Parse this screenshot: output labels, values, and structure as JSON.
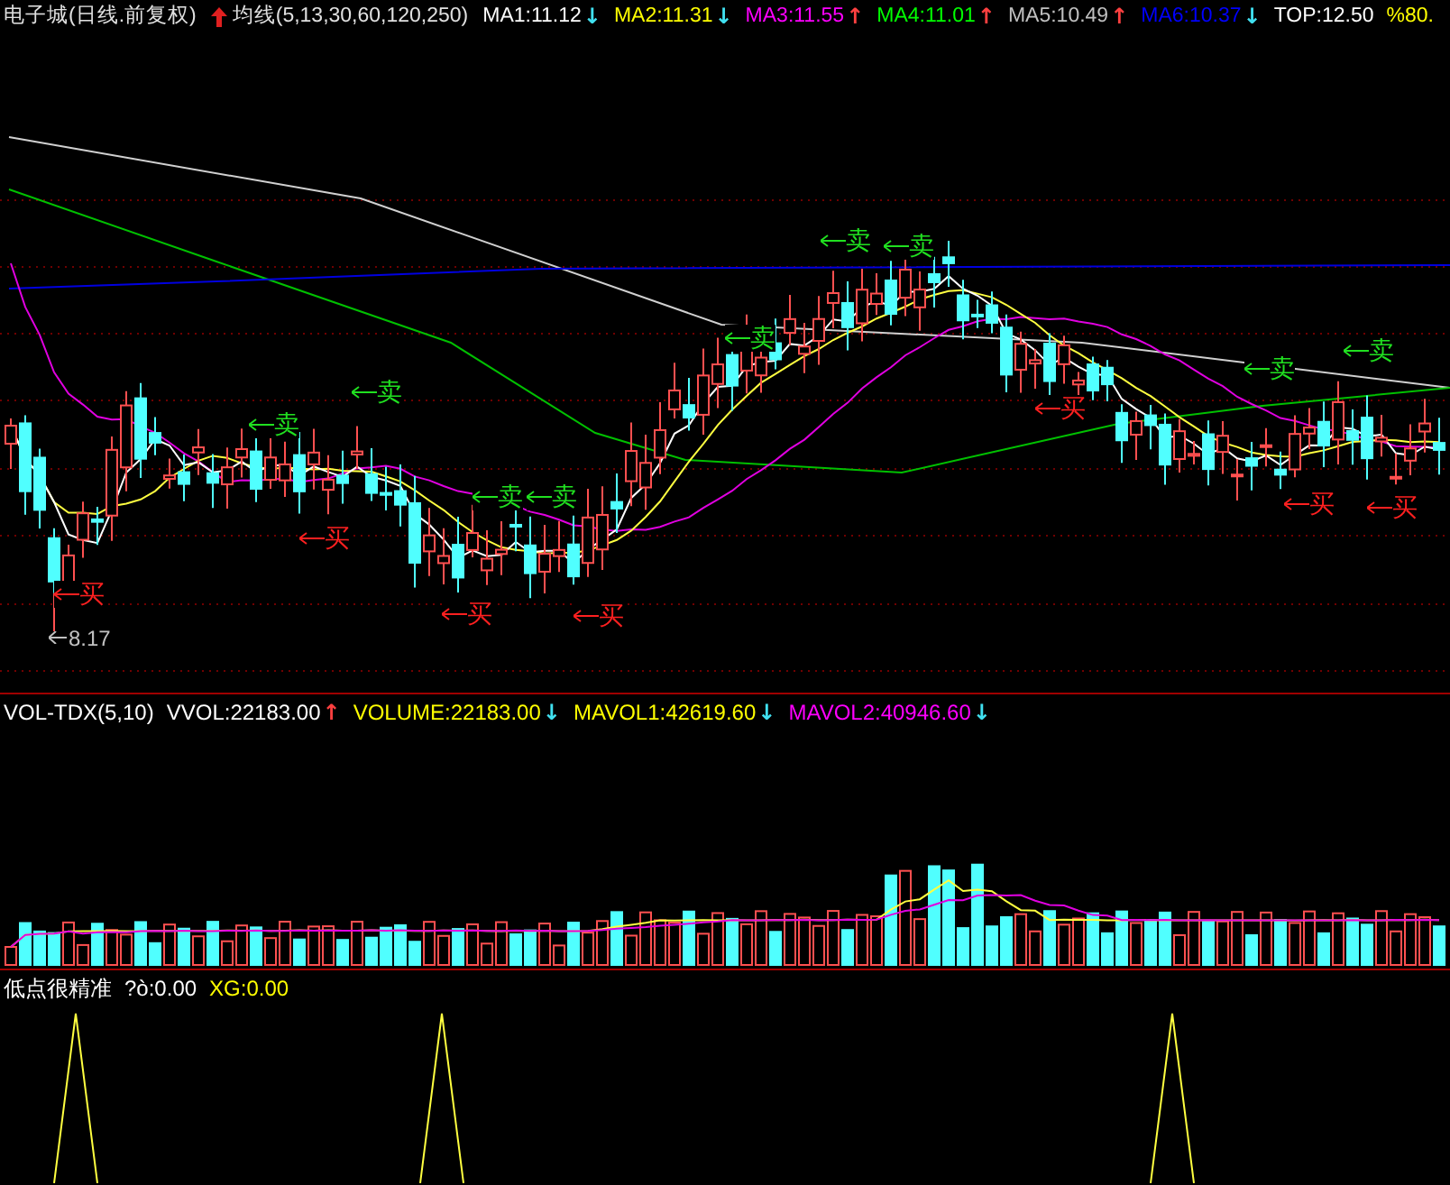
{
  "price_panel": {
    "title": "电子城(日线.前复权)",
    "indicator": "均线(5,13,30,60,120,250)",
    "readings": [
      {
        "text": "MA1:11.12",
        "color": "#ffffff",
        "arrow": {
          "text": "↓",
          "color": "#40e0f0"
        }
      },
      {
        "text": "MA2:11.31",
        "color": "#ffff00",
        "arrow": {
          "text": "↓",
          "color": "#40e0f0"
        }
      },
      {
        "text": "MA3:11.55",
        "color": "#ff00ff",
        "arrow": {
          "text": "↑",
          "color": "#ff4040"
        }
      },
      {
        "text": "MA4:11.01",
        "color": "#00ff00",
        "arrow": {
          "text": "↑",
          "color": "#ff4040"
        }
      },
      {
        "text": "MA5:10.49",
        "color": "#c0c0c0",
        "arrow": {
          "text": "↑",
          "color": "#ff4040"
        }
      },
      {
        "text": "MA6:10.37",
        "color": "#0000ff",
        "arrow": {
          "text": "↓",
          "color": "#40e0f0"
        }
      },
      {
        "text": "TOP:12.50",
        "color": "#ffffff"
      },
      {
        "text": "%80.",
        "color": "#ffff00"
      }
    ],
    "low_label": "8.17",
    "signals": [
      {
        "kind": "sell",
        "label": "卖"
      },
      {
        "kind": "sell",
        "label": "卖"
      },
      {
        "kind": "sell",
        "label": "卖"
      },
      {
        "kind": "sell",
        "label": "卖"
      },
      {
        "kind": "sell",
        "label": "卖"
      },
      {
        "kind": "sell",
        "label": "卖"
      },
      {
        "kind": "sell",
        "label": "卖"
      },
      {
        "kind": "sell",
        "label": "卖"
      },
      {
        "kind": "sell",
        "label": "卖"
      },
      {
        "kind": "buy",
        "label": "买"
      },
      {
        "kind": "buy",
        "label": "买"
      },
      {
        "kind": "buy",
        "label": "买"
      },
      {
        "kind": "buy",
        "label": "买"
      },
      {
        "kind": "buy",
        "label": "买"
      },
      {
        "kind": "buy",
        "label": "买"
      },
      {
        "kind": "buy",
        "label": "买"
      }
    ]
  },
  "volume_panel": {
    "readings": [
      {
        "text": "VOL-TDX(5,10)",
        "color": "#ffffff"
      },
      {
        "text": "VVOL:22183.00",
        "color": "#ffffff",
        "arrow": {
          "text": "↑",
          "color": "#ff4040"
        }
      },
      {
        "text": "VOLUME:22183.00",
        "color": "#ffff00",
        "arrow": {
          "text": "↓",
          "color": "#40e0f0"
        }
      },
      {
        "text": "MAVOL1:42619.60",
        "color": "#ffff00",
        "arrow": {
          "text": "↓",
          "color": "#40e0f0"
        }
      },
      {
        "text": "MAVOL2:40946.60",
        "color": "#ff00ff",
        "arrow": {
          "text": "↓",
          "color": "#40e0f0"
        }
      }
    ]
  },
  "signal_panel": {
    "readings": [
      {
        "text": "低点很精准",
        "color": "#ffffff"
      },
      {
        "text": "?ò:0.00",
        "color": "#ffffff"
      },
      {
        "text": "XG:0.00",
        "color": "#ffff00"
      }
    ]
  }
}
